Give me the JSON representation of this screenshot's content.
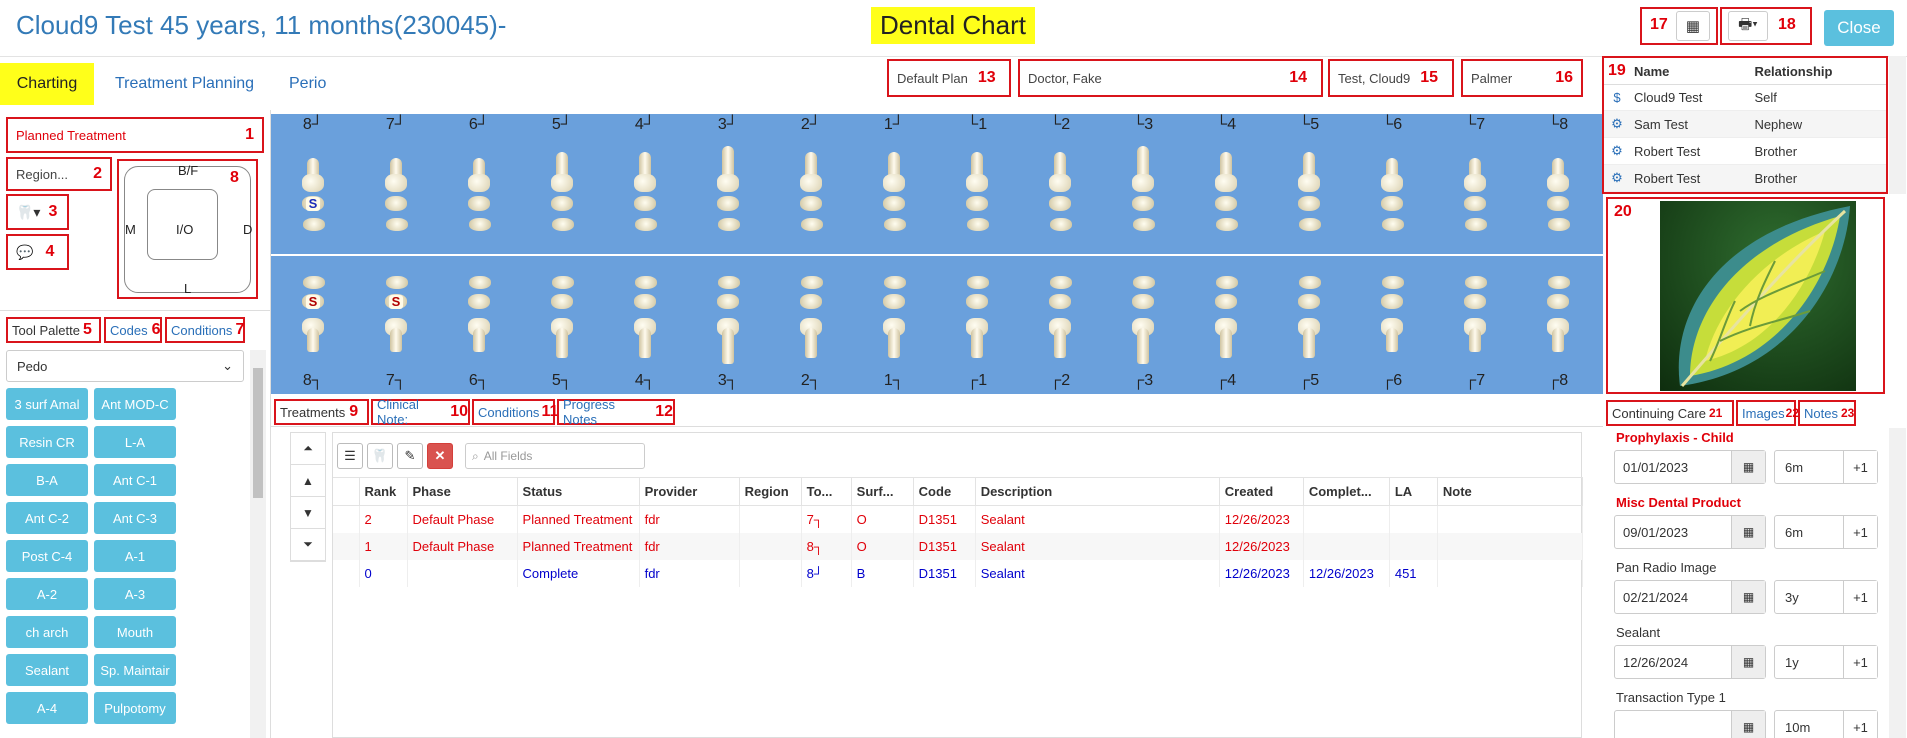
{
  "header": {
    "patient_title": "Cloud9 Test 45 years, 11 months(230045)-",
    "chart_title": "Dental Chart",
    "close_label": "Close"
  },
  "tabs": {
    "charting": "Charting",
    "treatment_planning": "Treatment Planning",
    "perio": "Perio"
  },
  "fields": {
    "plan": "Default Plan",
    "doctor": "Doctor, Fake",
    "patient": "Test, Cloud9",
    "numbering": "Palmer"
  },
  "left": {
    "planned_treatment": "Planned Treatment",
    "region": "Region...",
    "surfaces": {
      "top": "B/F",
      "left": "M",
      "center": "I/O",
      "right": "D",
      "bottom": "L"
    },
    "tool_palette": "Tool Palette",
    "codes": "Codes",
    "conditions": "Conditions",
    "palette_select": "Pedo",
    "palette_buttons": [
      "3 surf Amal",
      "Ant MOD-C",
      "Resin CR",
      "L-A",
      "B-A",
      "Ant C-1",
      "Ant C-2",
      "Ant C-3",
      "Post C-4",
      "A-1",
      "A-2",
      "A-3",
      "ch arch",
      "Mouth",
      "Sealant",
      "Sp. Maintair",
      "A-4",
      "Pulpotomy"
    ]
  },
  "tooth_chart": {
    "upper_labels": [
      "8┘",
      "7┘",
      "6┘",
      "5┘",
      "4┘",
      "3┘",
      "2┘",
      "1┘",
      "└1",
      "└2",
      "└3",
      "└4",
      "└5",
      "└6",
      "└7",
      "└8"
    ],
    "lower_labels": [
      "8┐",
      "7┐",
      "6┐",
      "5┐",
      "4┐",
      "3┐",
      "2┐",
      "1┐",
      "┌1",
      "┌2",
      "┌3",
      "┌4",
      "┌5",
      "┌6",
      "┌7",
      "┌8"
    ],
    "upper_sealant": "S",
    "lower_sealant_a": "S",
    "lower_sealant_b": "S"
  },
  "family": {
    "headers": [
      "Name",
      "Relationship"
    ],
    "rows": [
      {
        "icon": "$",
        "name": "Cloud9 Test",
        "relationship": "Self"
      },
      {
        "icon": "⚙",
        "name": "Sam Test",
        "relationship": "Nephew"
      },
      {
        "icon": "⚙",
        "name": "Robert Test",
        "relationship": "Brother"
      },
      {
        "icon": "⚙",
        "name": "Robert Test",
        "relationship": "Brother"
      }
    ]
  },
  "subtabs": {
    "treatments": "Treatments",
    "clinical_notes": "Clinical Note:",
    "conditions": "Conditions",
    "progress_notes": "Progress Notes"
  },
  "treatments": {
    "search_placeholder": "All Fields",
    "headers": [
      "Rank",
      "Phase",
      "Status",
      "Provider",
      "Region",
      "To...",
      "Surf...",
      "Code",
      "Description",
      "Created",
      "Complet...",
      "LA",
      "Note"
    ],
    "rows": [
      [
        "2",
        "Default Phase",
        "Planned Treatment",
        "fdr",
        "",
        "7┐",
        "O",
        "D1351",
        "Sealant",
        "12/26/2023",
        "",
        "",
        ""
      ],
      [
        "1",
        "Default Phase",
        "Planned Treatment",
        "fdr",
        "",
        "8┐",
        "O",
        "D1351",
        "Sealant",
        "12/26/2023",
        "",
        "",
        ""
      ],
      [
        "0",
        "",
        "Complete",
        "fdr",
        "",
        "8┘",
        "B",
        "D1351",
        "Sealant",
        "12/26/2023",
        "12/26/2023",
        "451",
        ""
      ]
    ]
  },
  "right_tabs": {
    "continuing_care": "Continuing Care",
    "images": "Images",
    "notes": "Notes"
  },
  "continuing_care": [
    {
      "title": "Prophylaxis - Child",
      "date": "01/01/2023",
      "interval": "6m",
      "highlight": true
    },
    {
      "title": "Misc Dental Product",
      "date": "09/01/2023",
      "interval": "6m",
      "highlight": true
    },
    {
      "title": "Pan Radio Image",
      "date": "02/21/2024",
      "interval": "3y",
      "highlight": false
    },
    {
      "title": "Sealant",
      "date": "12/26/2024",
      "interval": "1y",
      "highlight": false
    },
    {
      "title": "Transaction Type 1",
      "date": "",
      "interval": "10m",
      "highlight": false
    }
  ],
  "increment_label": "+1",
  "annotations": [
    "1",
    "2",
    "3",
    "4",
    "5",
    "6",
    "7",
    "8",
    "9",
    "10",
    "11",
    "12",
    "13",
    "14",
    "15",
    "16",
    "17",
    "18",
    "19",
    "20",
    "21",
    "22",
    "23"
  ],
  "colors": {
    "accent": "#337ab7",
    "highlight": "#ffff1a",
    "annotation": "#d9141b",
    "button": "#5bc0de",
    "chart_bg": "#6aa0dc"
  }
}
